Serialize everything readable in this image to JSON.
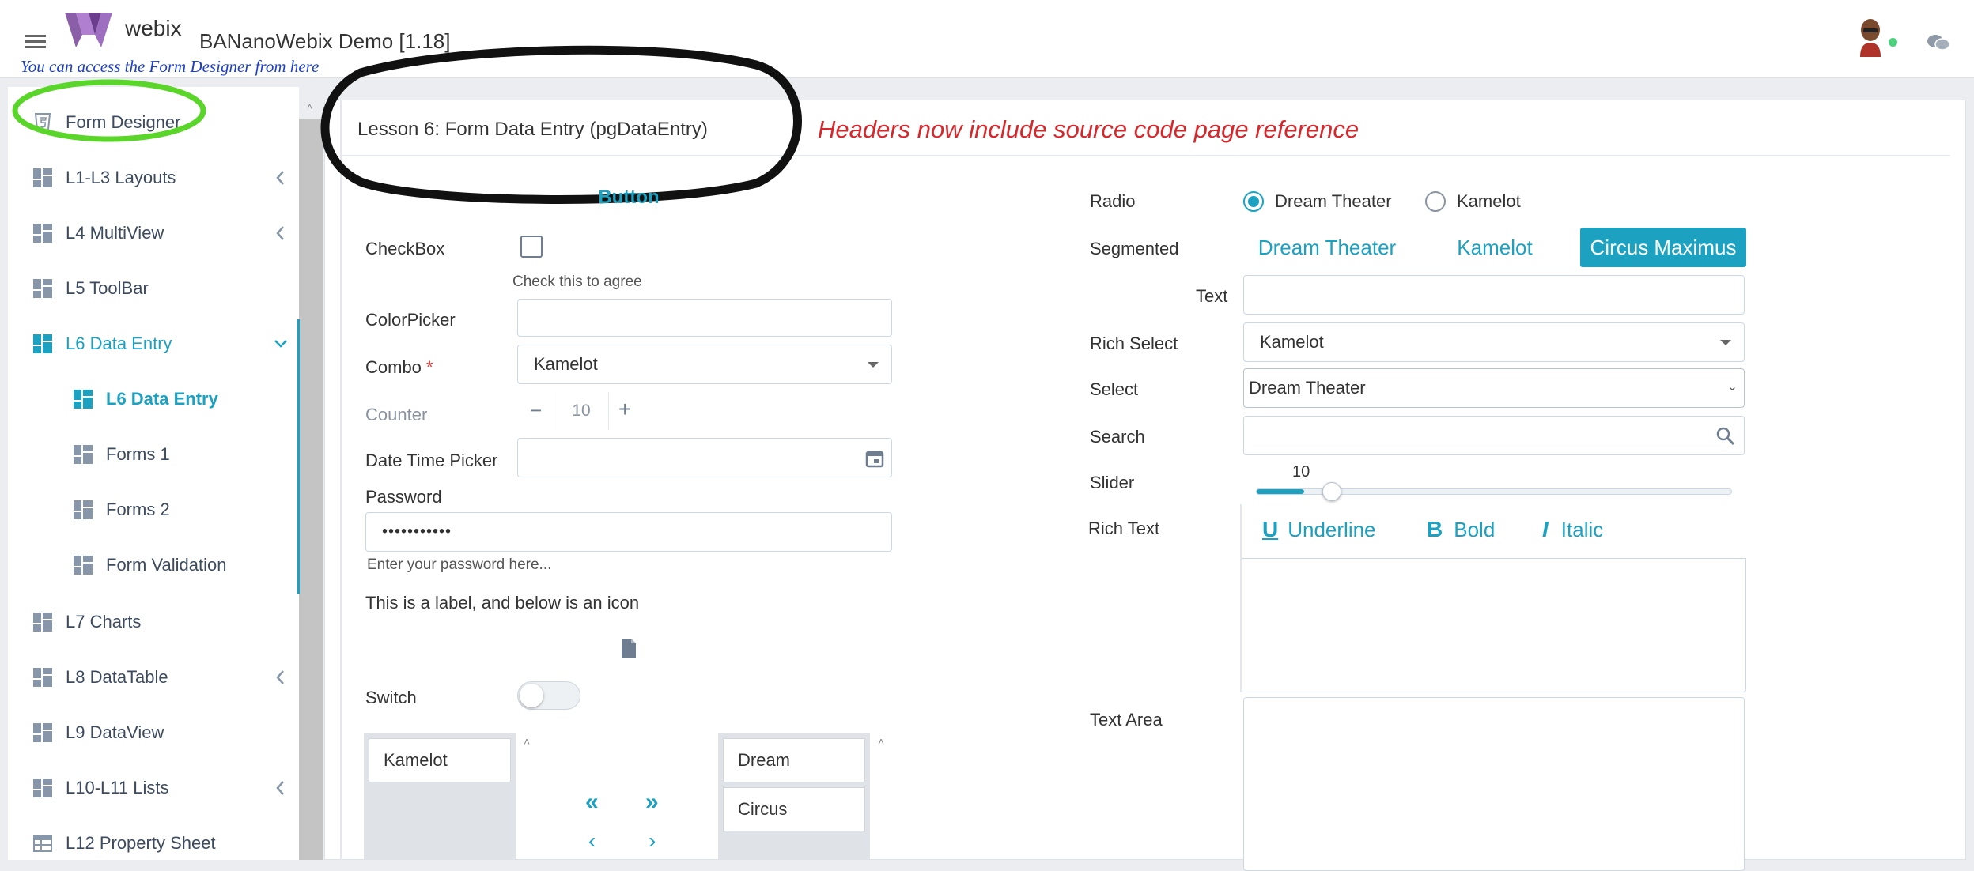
{
  "header": {
    "logo_text": "webix",
    "title": "BANanoWebix Demo [1.18]",
    "annotation": "You can access the Form Designer from here"
  },
  "sidebar": {
    "items": [
      {
        "label": "Form Designer",
        "icon": "html5-icon"
      },
      {
        "label": "L1-L3 Layouts",
        "icon": "dashboard-icon",
        "chevron": "left"
      },
      {
        "label": "L4 MultiView",
        "icon": "dashboard-icon",
        "chevron": "left"
      },
      {
        "label": "L5 ToolBar",
        "icon": "dashboard-icon"
      },
      {
        "label": "L6 Data Entry",
        "icon": "dashboard-icon",
        "chevron": "down"
      },
      {
        "label": "L6 Data Entry",
        "icon": "dashboard-icon",
        "sub": true,
        "selected": true
      },
      {
        "label": "Forms 1",
        "icon": "dashboard-icon",
        "sub": true
      },
      {
        "label": "Forms 2",
        "icon": "dashboard-icon",
        "sub": true
      },
      {
        "label": "Form Validation",
        "icon": "dashboard-icon",
        "sub": true
      },
      {
        "label": "L7 Charts",
        "icon": "dashboard-icon"
      },
      {
        "label": "L8 DataTable",
        "icon": "dashboard-icon",
        "chevron": "left"
      },
      {
        "label": "L9 DataView",
        "icon": "dashboard-icon"
      },
      {
        "label": "L10-L11 Lists",
        "icon": "dashboard-icon",
        "chevron": "left"
      },
      {
        "label": "L12 Property Sheet",
        "icon": "table-icon"
      }
    ]
  },
  "panel": {
    "header": "Lesson 6: Form Data Entry (pgDataEntry)",
    "annotation": "Headers now include source code page reference"
  },
  "form": {
    "button_label": "Button",
    "checkbox_label": "CheckBox",
    "checkbox_hint": "Check this to agree",
    "colorpicker_label": "ColorPicker",
    "combo_label": "Combo",
    "combo_required": "*",
    "combo_value": "Kamelot",
    "counter_label": "Counter",
    "counter_minus": "−",
    "counter_value": "10",
    "counter_plus": "+",
    "datetime_label": "Date Time Picker",
    "password_label": "Password",
    "password_value": "•••••••••••",
    "password_hint": "Enter your password here...",
    "label_text": "This is a label, and below is an icon",
    "switch_label": "Switch",
    "dbllist_left": [
      "Kamelot"
    ],
    "dbllist_right": [
      "Dream",
      "Circus"
    ],
    "radio_label": "Radio",
    "radio_options": [
      "Dream Theater",
      "Kamelot"
    ],
    "radio_selected": 0,
    "segmented_label": "Segmented",
    "segmented_options": [
      "Dream Theater",
      "Kamelot",
      "Circus Maximus"
    ],
    "segmented_selected": 2,
    "text_label": "Text",
    "richselect_label": "Rich Select",
    "richselect_value": "Kamelot",
    "select_label": "Select",
    "select_value": "Dream Theater",
    "search_label": "Search",
    "slider_label": "Slider",
    "slider_value": "10",
    "slider_fraction": 0.1,
    "richtext_label": "Rich Text",
    "richtext_buttons": [
      "Underline",
      "Bold",
      "Italic"
    ],
    "textarea_label": "Text Area"
  },
  "colors": {
    "accent": "#1ca1c1",
    "annotation_red": "#d9262b",
    "annotation_blue": "#1a3fcf",
    "highlight_green": "#5ad62a",
    "status_online": "#4cd07d"
  }
}
